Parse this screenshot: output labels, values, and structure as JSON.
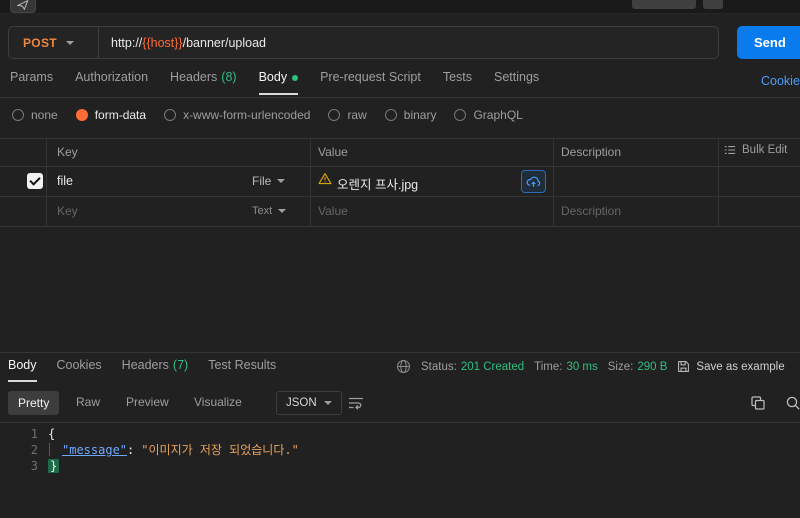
{
  "request": {
    "method": "POST",
    "url_protocol": "http://",
    "url_variable": "{{host}}",
    "url_path": "/banner/upload",
    "send_label": "Send"
  },
  "request_tabs": {
    "params": "Params",
    "authorization": "Authorization",
    "headers": "Headers",
    "headers_count": "(8)",
    "body": "Body",
    "pre_request": "Pre-request Script",
    "tests": "Tests",
    "settings": "Settings",
    "cookies_link": "Cookies"
  },
  "body_types": {
    "none": "none",
    "form_data": "form-data",
    "urlencoded": "x-www-form-urlencoded",
    "raw": "raw",
    "binary": "binary",
    "graphql": "GraphQL"
  },
  "form_table": {
    "col_key": "Key",
    "col_value": "Value",
    "col_description": "Description",
    "bulk_edit": "Bulk Edit",
    "row1": {
      "key": "file",
      "type": "File",
      "file_name": "오렌지 프사.jpg"
    },
    "row2": {
      "key_placeholder": "Key",
      "type": "Text",
      "value_placeholder": "Value",
      "description_placeholder": "Description"
    }
  },
  "response": {
    "tab_body": "Body",
    "tab_cookies": "Cookies",
    "tab_headers": "Headers",
    "tab_headers_count": "(7)",
    "tab_test_results": "Test Results",
    "status_label": "Status:",
    "status_value": "201 Created",
    "time_label": "Time:",
    "time_value": "30 ms",
    "size_label": "Size:",
    "size_value": "290 B",
    "save_as_example": "Save as example",
    "views": {
      "pretty": "Pretty",
      "raw": "Raw",
      "preview": "Preview",
      "visualize": "Visualize"
    },
    "format": "JSON",
    "code": {
      "line1_no": "1",
      "line2_no": "2",
      "line3_no": "3",
      "line1": "{",
      "line2_key": "\"message\"",
      "line2_sep": ":",
      "line2_value": "\"이미지가 저장 되었습니다.\"",
      "line3": "}"
    }
  },
  "colors": {
    "method_post": "#f0883e",
    "variable_orange": "#ff6c37",
    "send_blue": "#097bed",
    "success_green": "#2fbf7f",
    "link_blue": "#4a9eff"
  },
  "icons": [
    "send-icon",
    "chevron-down-icon",
    "warning-icon",
    "upload-cloud-icon",
    "globe-icon",
    "save-icon",
    "copy-icon",
    "search-icon",
    "wrap-text-icon",
    "bulk-edit-icon"
  ]
}
